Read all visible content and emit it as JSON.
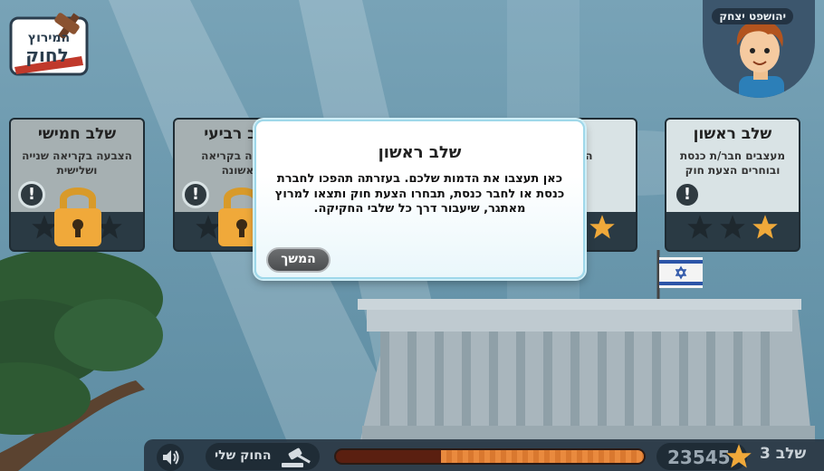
{
  "player": {
    "name": "יהושפט יצחק"
  },
  "stages": [
    {
      "title": "שלב ראשון",
      "description": "מעצבים חבר/ת כנסת ובוחרים הצעת חוק",
      "state": "active",
      "stars_earned": 1
    },
    {
      "title": "שלב",
      "description": "הצבעה ב",
      "state": "hidden",
      "stars_earned": 1
    },
    {
      "title": "שלב רביעי",
      "description": "הצבעה בקריאה ראשונה",
      "state": "locked",
      "stars_earned": 0
    },
    {
      "title": "שלב חמישי",
      "description": "הצבעה בקריאה שנייה ושלישית",
      "state": "locked",
      "stars_earned": 0
    }
  ],
  "dialog": {
    "title": "שלב ראשון",
    "body": "כאן תעצבו את הדמות שלכם. בעזרתה תהפכו לחברת כנסת או לחבר כנסת, תבחרו הצעת חוק ותצאו למרוץ מאתגר, שיעבור דרך כל שלבי החקיקה.",
    "continue_label": "המשך"
  },
  "bottom_bar": {
    "my_law_label": "החוק שלי",
    "score": "23545",
    "level_label": "שלב 3",
    "progress": 0.66
  },
  "colors": {
    "star_gold": "#f0a93a",
    "progress": "#e98a3e"
  },
  "icons": [
    "logo",
    "info-icon",
    "lock-icon",
    "star-icon",
    "sound-icon",
    "gavel-icon",
    "flag"
  ]
}
